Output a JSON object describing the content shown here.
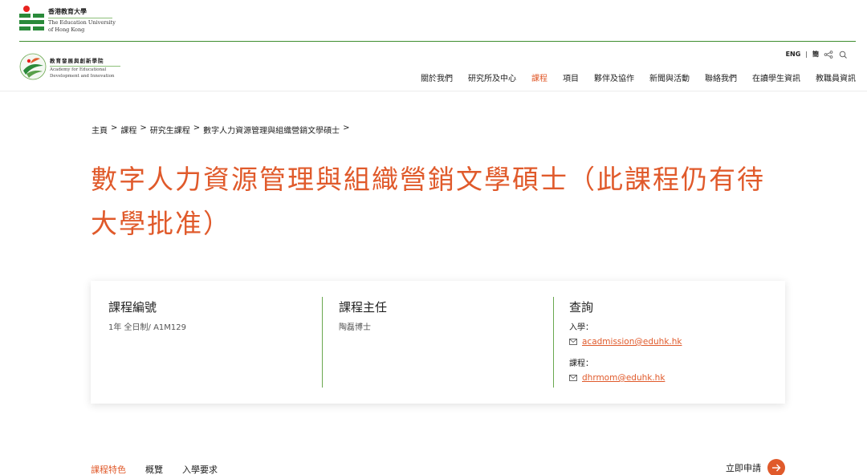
{
  "university": {
    "name_zh": "香港教育大學",
    "name_en_line1": "The Education University",
    "name_en_line2": "of Hong Kong"
  },
  "academy": {
    "name_zh": "教育發展與創新學院",
    "name_en_line1": "Academy for Educational",
    "name_en_line2": "Development and Innovation"
  },
  "utils": {
    "lang_eng": "ENG",
    "separator": "|",
    "lang_simplified": "簡"
  },
  "nav": {
    "items": [
      {
        "label": "關於我們"
      },
      {
        "label": "研究所及中心"
      },
      {
        "label": "課程"
      },
      {
        "label": "項目"
      },
      {
        "label": "夥伴及協作"
      },
      {
        "label": "新聞與活動"
      },
      {
        "label": "聯絡我們"
      },
      {
        "label": "在讀學生資訊"
      },
      {
        "label": "教職員資訊"
      }
    ],
    "active_index": 2
  },
  "breadcrumb": {
    "items": [
      "主頁",
      "課程",
      "研究生課程",
      "數字人力資源管理與組織營銷文學碩士"
    ],
    "separator": ">"
  },
  "page_title": "數字人力資源管理與組織營銷文學碩士（此課程仍有待大學批准）",
  "card": {
    "code": {
      "heading": "課程編號",
      "value": "1年 全日制/ A1M129"
    },
    "director": {
      "heading": "課程主任",
      "value": "陶磊博士"
    },
    "enquiry": {
      "heading": "查詢",
      "admission_label": "入學：",
      "admission_email": "acadmission@eduhk.hk",
      "programme_label": "課程：",
      "programme_email": "dhrmom@eduhk.hk"
    }
  },
  "tabs": {
    "items": [
      {
        "label": "課程特色"
      },
      {
        "label": "概覽"
      },
      {
        "label": "入學要求"
      }
    ],
    "active_index": 0
  },
  "apply_label": "立即申請",
  "colors": {
    "accent": "#e05a2b",
    "green": "#3e8e2f"
  }
}
